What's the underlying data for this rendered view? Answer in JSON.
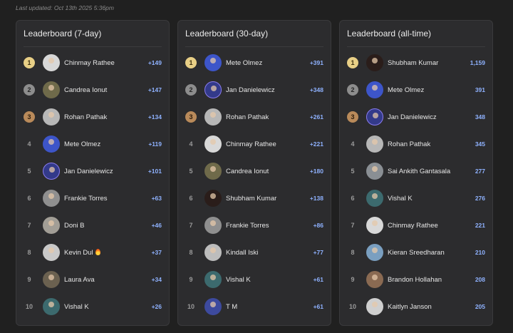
{
  "last_updated": "Last updated: Oct 13th 2025 5:36pm",
  "boards": [
    {
      "title": "Leaderboard (7-day)",
      "rows": [
        {
          "rank": "1",
          "medal": "gold",
          "name": "Chinmay Rathee",
          "score": "+149",
          "avatar_color": "#d8d8d8"
        },
        {
          "rank": "2",
          "medal": "silver",
          "name": "Candrea Ionut",
          "score": "+147",
          "avatar_color": "#6f6a4a"
        },
        {
          "rank": "3",
          "medal": "bronze",
          "name": "Rohan Pathak",
          "score": "+134",
          "avatar_color": "#b7b7b7"
        },
        {
          "rank": "4",
          "medal": "",
          "name": "Mete Olmez",
          "score": "+119",
          "avatar_color": "#3d55c9"
        },
        {
          "rank": "5",
          "medal": "",
          "name": "Jan Danielewicz",
          "score": "+101",
          "avatar_color": "#333a8a",
          "ring": true
        },
        {
          "rank": "6",
          "medal": "",
          "name": "Frankie Torres",
          "score": "+63",
          "avatar_color": "#8f8f8f"
        },
        {
          "rank": "7",
          "medal": "",
          "name": "Doni B",
          "score": "+46",
          "avatar_color": "#a29e96"
        },
        {
          "rank": "8",
          "medal": "",
          "name": "Kevin Dul",
          "score": "+37",
          "avatar_color": "#c9c9c9",
          "fire": true
        },
        {
          "rank": "9",
          "medal": "",
          "name": "Laura Ava",
          "score": "+34",
          "avatar_color": "#6b6150"
        },
        {
          "rank": "10",
          "medal": "",
          "name": "Vishal K",
          "score": "+26",
          "avatar_color": "#3c6a6e"
        }
      ]
    },
    {
      "title": "Leaderboard (30-day)",
      "rows": [
        {
          "rank": "1",
          "medal": "gold",
          "name": "Mete Olmez",
          "score": "+391",
          "avatar_color": "#3d55c9"
        },
        {
          "rank": "2",
          "medal": "silver",
          "name": "Jan Danielewicz",
          "score": "+348",
          "avatar_color": "#333a8a",
          "ring": true
        },
        {
          "rank": "3",
          "medal": "bronze",
          "name": "Rohan Pathak",
          "score": "+261",
          "avatar_color": "#b7b7b7"
        },
        {
          "rank": "4",
          "medal": "",
          "name": "Chinmay Rathee",
          "score": "+221",
          "avatar_color": "#d8d8d8"
        },
        {
          "rank": "5",
          "medal": "",
          "name": "Candrea Ionut",
          "score": "+180",
          "avatar_color": "#6f6a4a"
        },
        {
          "rank": "6",
          "medal": "",
          "name": "Shubham Kumar",
          "score": "+138",
          "avatar_color": "#2a1d1a"
        },
        {
          "rank": "7",
          "medal": "",
          "name": "Frankie Torres",
          "score": "+86",
          "avatar_color": "#8f8f8f"
        },
        {
          "rank": "8",
          "medal": "",
          "name": "Kindall Iski",
          "score": "+77",
          "avatar_color": "#bdbdbd"
        },
        {
          "rank": "9",
          "medal": "",
          "name": "Vishal K",
          "score": "+61",
          "avatar_color": "#3c6a6e"
        },
        {
          "rank": "10",
          "medal": "",
          "name": "T M",
          "score": "+61",
          "avatar_color": "#3d4a9e"
        }
      ]
    },
    {
      "title": "Leaderboard (all-time)",
      "rows": [
        {
          "rank": "1",
          "medal": "gold",
          "name": "Shubham Kumar",
          "score": "1,159",
          "avatar_color": "#2a1d1a"
        },
        {
          "rank": "2",
          "medal": "silver",
          "name": "Mete Olmez",
          "score": "391",
          "avatar_color": "#3d55c9"
        },
        {
          "rank": "3",
          "medal": "bronze",
          "name": "Jan Danielewicz",
          "score": "348",
          "avatar_color": "#333a8a",
          "ring": true
        },
        {
          "rank": "4",
          "medal": "",
          "name": "Rohan Pathak",
          "score": "345",
          "avatar_color": "#b7b7b7"
        },
        {
          "rank": "5",
          "medal": "",
          "name": "Sai Ankith Gantasala",
          "score": "277",
          "avatar_color": "#8a8f94"
        },
        {
          "rank": "6",
          "medal": "",
          "name": "Vishal K",
          "score": "276",
          "avatar_color": "#3c6a6e"
        },
        {
          "rank": "7",
          "medal": "",
          "name": "Chinmay Rathee",
          "score": "221",
          "avatar_color": "#d8d8d8"
        },
        {
          "rank": "8",
          "medal": "",
          "name": "Kieran Sreedharan",
          "score": "210",
          "avatar_color": "#7a9fc0"
        },
        {
          "rank": "9",
          "medal": "",
          "name": "Brandon Hollahan",
          "score": "208",
          "avatar_color": "#8a6a52"
        },
        {
          "rank": "10",
          "medal": "",
          "name": "Kaitlyn Janson",
          "score": "205",
          "avatar_color": "#cfcfcf"
        }
      ]
    }
  ]
}
